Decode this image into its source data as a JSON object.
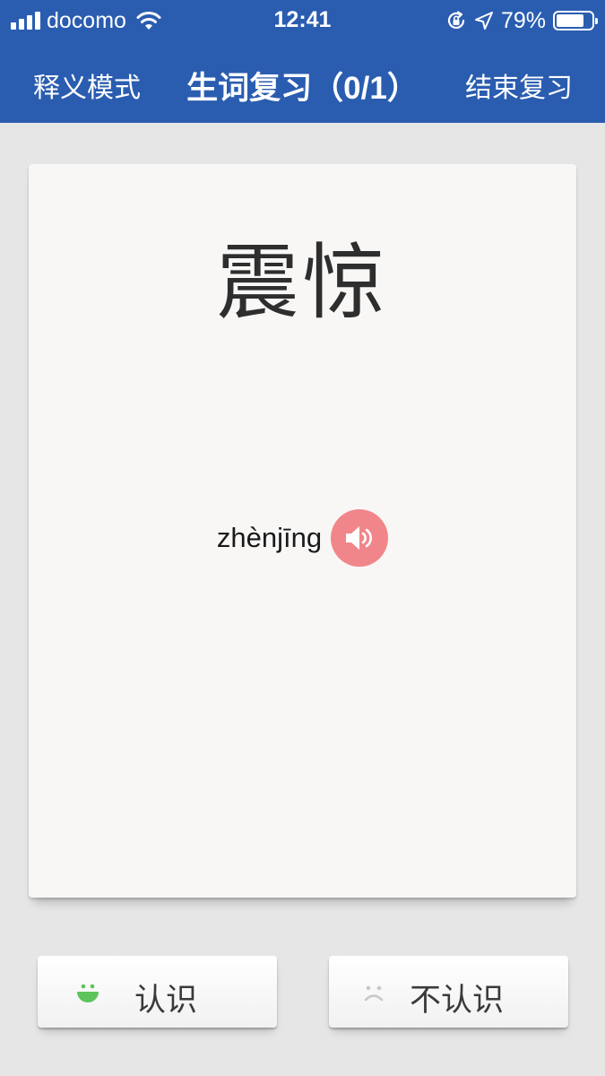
{
  "status_bar": {
    "carrier": "docomo",
    "time": "12:41",
    "battery_percent": "79%",
    "battery_level": 0.79,
    "icons": [
      "signal-icon",
      "wifi-icon",
      "orientation-lock-icon",
      "location-arrow-icon",
      "battery-icon"
    ]
  },
  "nav": {
    "mode_label": "释义模式",
    "title": "生词复习（0/1）",
    "end_label": "结束复习"
  },
  "card": {
    "word": "震惊",
    "pinyin": "zhènjīng",
    "speaker_icon": "speaker-icon"
  },
  "actions": {
    "know_label": "认识",
    "know_icon": "happy-face-icon",
    "unknown_label": "不认识",
    "unknown_icon": "sad-face-icon"
  },
  "colors": {
    "header": "#2a5db0",
    "background": "#e6e6e6",
    "card": "#f8f7f6",
    "speaker": "#f1868a",
    "know_icon": "#5cc45a",
    "unknown_icon": "#c8c8c8"
  }
}
